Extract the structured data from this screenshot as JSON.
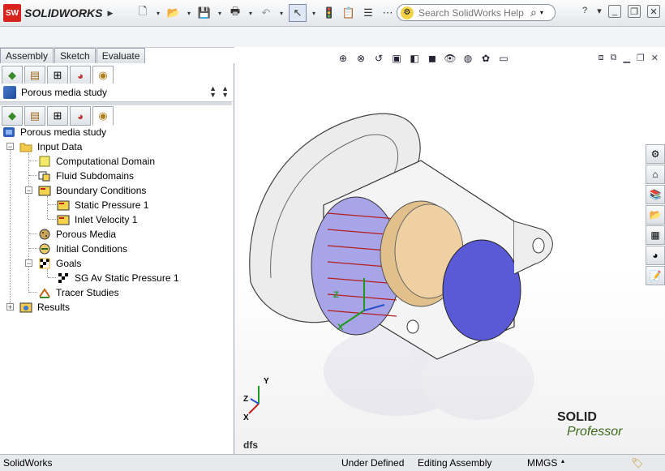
{
  "app": {
    "name": "SOLIDWORKS",
    "logo_abbrev": "SW"
  },
  "search": {
    "placeholder": "Search SolidWorks Help"
  },
  "command_tabs": [
    "Assembly",
    "Sketch",
    "Evaluate"
  ],
  "study_selector": {
    "label": "Porous media study"
  },
  "tree": {
    "root": "Porous media study",
    "input_data": "Input Data",
    "computational_domain": "Computational Domain",
    "fluid_subdomains": "Fluid Subdomains",
    "boundary_conditions": "Boundary Conditions",
    "static_pressure": "Static Pressure 1",
    "inlet_velocity": "Inlet Velocity 1",
    "porous_media": "Porous Media",
    "initial_conditions": "Initial Conditions",
    "goals": "Goals",
    "sg_goal": "SG Av Static Pressure 1",
    "tracer_studies": "Tracer Studies",
    "results": "Results"
  },
  "viewport": {
    "document_label": "dfs",
    "triad": {
      "x": "X",
      "y": "Y",
      "z": "Z"
    },
    "watermark": {
      "line1": "SOLID",
      "line2": "Professor"
    }
  },
  "status": {
    "app": "SolidWorks",
    "define_state": "Under Defined",
    "mode": "Editing Assembly",
    "units": "MMGS"
  },
  "colors": {
    "flow_arrow": "#b41e1e",
    "porous_disc": "#e2c08c",
    "outlet_lid": "#5a5ad6",
    "accent": "#d8241e"
  }
}
